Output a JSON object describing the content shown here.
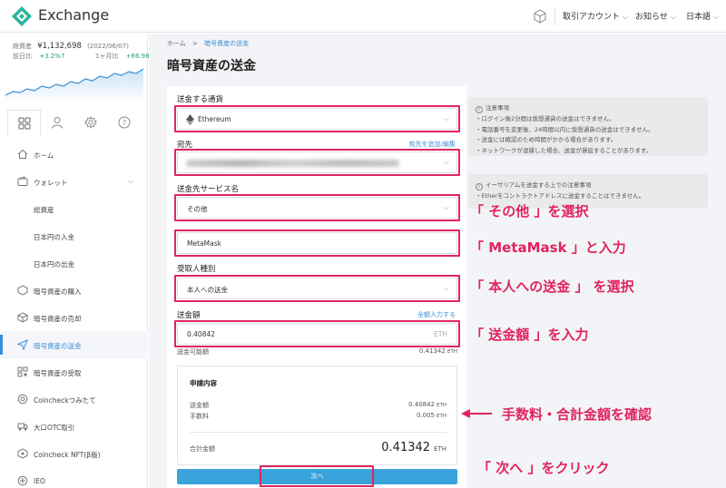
{
  "app": {
    "title": "Exchange",
    "brand_color": "#2cb5a0"
  },
  "topbar": {
    "menu": [
      {
        "label": "取引アカウント",
        "icon": "chevron-down-icon"
      },
      {
        "label": "お知らせ",
        "icon": "chevron-down-icon"
      },
      {
        "label": "日本語",
        "icon": "chevron-down-icon"
      }
    ],
    "cube_icon": "cube-icon"
  },
  "sidebar": {
    "assets": {
      "total_label": "総資産",
      "total_value": "¥1,132,698",
      "date": "(2022/06/07)",
      "day_label": "前日比",
      "day_change": "+3.2%↑",
      "month_label": "1ヶ月比",
      "month_change": "+66.98%↑"
    },
    "tabs": [
      "grid-icon",
      "user-icon",
      "gear-icon",
      "help-icon"
    ],
    "items": [
      {
        "label": "ホーム",
        "icon": "home-icon"
      },
      {
        "label": "ウォレット",
        "icon": "wallet-icon"
      },
      {
        "label": "総資産"
      },
      {
        "label": "日本円の入金"
      },
      {
        "label": "日本円の出金"
      },
      {
        "label": "暗号資産の購入",
        "icon": "buy-icon"
      },
      {
        "label": "暗号資産の売却",
        "icon": "sell-icon"
      },
      {
        "label": "暗号資産の送金",
        "icon": "send-icon"
      },
      {
        "label": "暗号資産の受取",
        "icon": "qr-icon"
      },
      {
        "label": "Coincheckつみたて",
        "icon": "savings-icon"
      },
      {
        "label": "大口OTC取引",
        "icon": "truck-icon"
      },
      {
        "label": "Coincheck NFT(β版)",
        "icon": "nft-icon"
      },
      {
        "label": "IEO",
        "icon": "ieo-icon"
      }
    ],
    "active_color": "#3a8ed4"
  },
  "main": {
    "breadcrumb": {
      "home": "ホーム",
      "current": "暗号資産の送金"
    },
    "title": "暗号資産の送金",
    "form": {
      "currency_label": "送金する通貨",
      "currency_value": "Ethereum",
      "dest_label": "宛先",
      "dest_link": "宛先を追加/編集",
      "service_label": "送金先サービス名",
      "service_value": "その他",
      "service_input": "MetaMask",
      "recipient_label": "受取人種別",
      "recipient_value": "本人への送金",
      "amount_label": "送金額",
      "amount_link": "全額入力する",
      "amount_value": "0.40842",
      "amount_unit": "ETH",
      "available_label": "送金可能額",
      "available_value": "0.41342",
      "available_unit": "ETH"
    },
    "summary": {
      "title": "申請内容",
      "amount_label": "送金額",
      "amount_value": "0.40842",
      "fee_label": "手数料",
      "fee_value": "0.005",
      "total_label": "合計金額",
      "total_value": "0.41342",
      "unit": "ETH"
    },
    "next_button": "次へ",
    "notes": [
      {
        "title": "注意事項",
        "items": [
          "ログイン後2分間は仮想通貨の送金はできません。",
          "電話番号を変更後、24時間以内に仮想通貨の送金はできません。",
          "送金には確認のため時間がかかる場合があります。",
          "ネットワークが混雑した場合、送金が遅延することがあります。"
        ]
      },
      {
        "title": "イーサリアムを送金する上での注意事項",
        "items": [
          "Etherをコントラクトアドレスに送金することはできません。"
        ]
      }
    ]
  },
  "annotations": {
    "color": "#e0245e",
    "select_other": "「 その他 」を選択",
    "enter_metamask": "「 MetaMask 」と入力",
    "select_self": "「 本人への送金 」 を選択",
    "enter_amount": "「 送金額 」を入力",
    "confirm_fee": "手数料・合計金額を確認",
    "click_next": "「 次へ 」をクリック"
  }
}
